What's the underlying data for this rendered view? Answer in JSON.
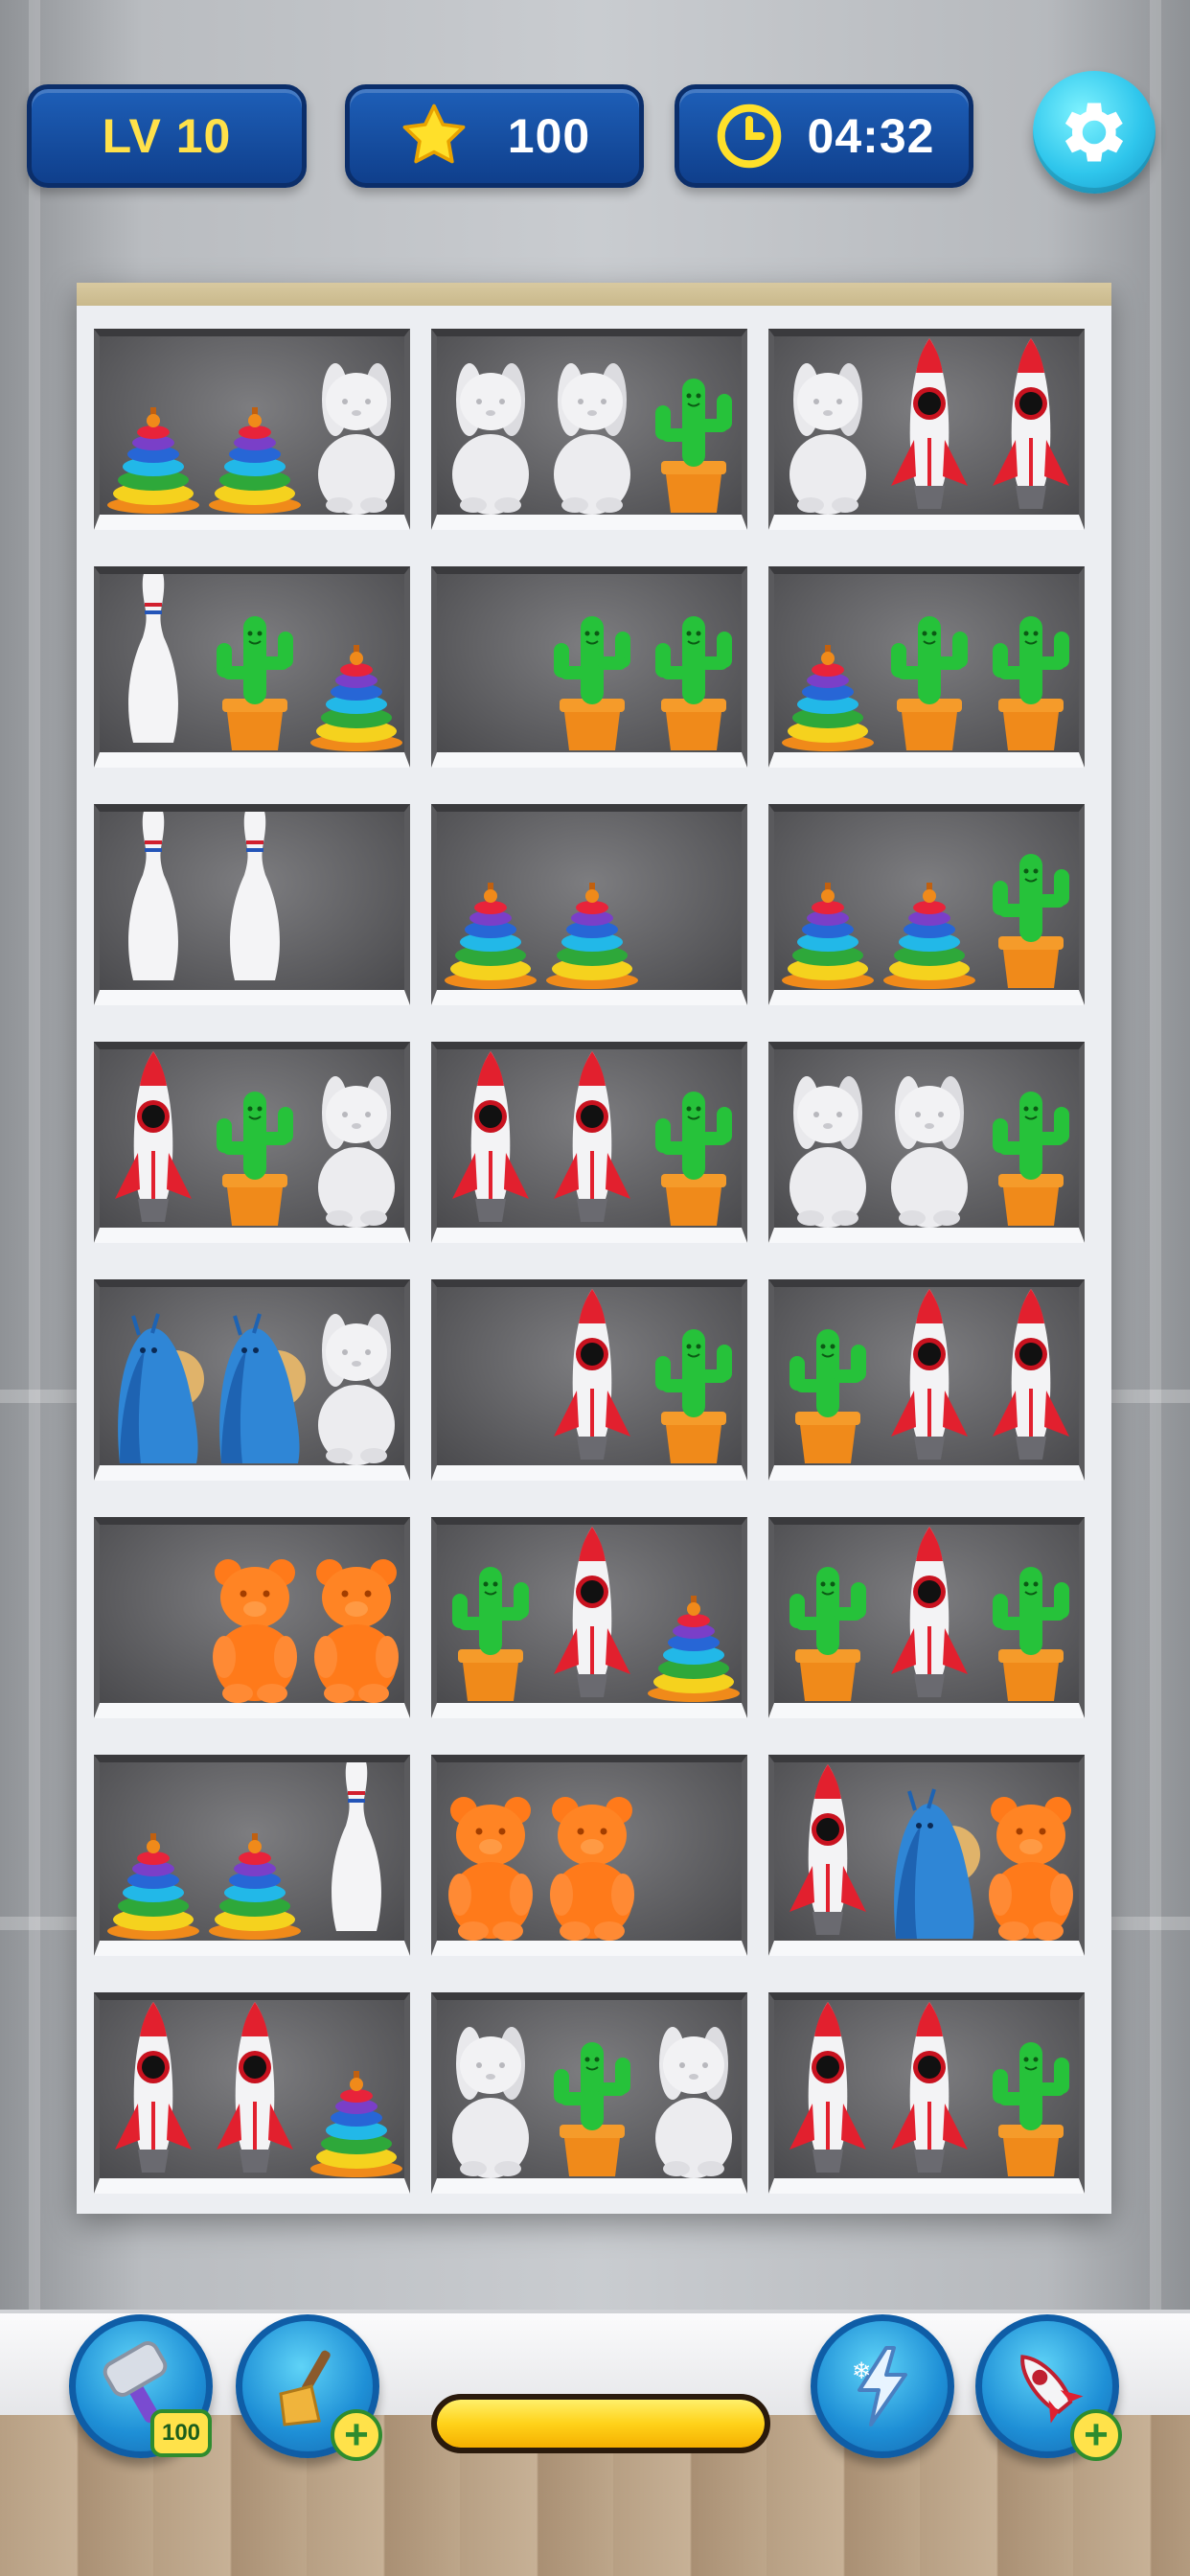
{
  "hud": {
    "level_label": "LV 10",
    "stars": "100",
    "timer": "04:32"
  },
  "shelf": {
    "rows": [
      [
        [
          "pyramid",
          "pyramid",
          "bunny"
        ],
        [
          "bunny",
          "bunny",
          "cactus"
        ],
        [
          "bunny",
          "rocket",
          "rocket"
        ]
      ],
      [
        [
          "pin",
          "cactus",
          "pyramid"
        ],
        [
          "empty",
          "cactus",
          "cactus"
        ],
        [
          "pyramid",
          "cactus",
          "cactus"
        ]
      ],
      [
        [
          "pin",
          "pin",
          "empty"
        ],
        [
          "pyramid",
          "pyramid",
          "empty"
        ],
        [
          "pyramid",
          "pyramid",
          "cactus"
        ]
      ],
      [
        [
          "rocket",
          "cactus",
          "bunny"
        ],
        [
          "rocket",
          "rocket",
          "cactus"
        ],
        [
          "bunny",
          "bunny",
          "cactus"
        ]
      ],
      [
        [
          "snail",
          "snail",
          "bunny"
        ],
        [
          "empty",
          "rocket",
          "cactus"
        ],
        [
          "cactus",
          "rocket",
          "rocket"
        ]
      ],
      [
        [
          "empty",
          "bear",
          "bear"
        ],
        [
          "cactus",
          "rocket",
          "pyramid"
        ],
        [
          "cactus",
          "rocket",
          "cactus"
        ]
      ],
      [
        [
          "pyramid",
          "pyramid",
          "pin"
        ],
        [
          "bear",
          "bear",
          "empty"
        ],
        [
          "rocket",
          "snail",
          "bear"
        ]
      ],
      [
        [
          "rocket",
          "rocket",
          "pyramid"
        ],
        [
          "bunny",
          "cactus",
          "bunny"
        ],
        [
          "rocket",
          "rocket",
          "cactus"
        ]
      ]
    ]
  },
  "boosters": {
    "hammer": {
      "icon": "hammer-icon",
      "count": "100"
    },
    "broom": {
      "icon": "broom-icon",
      "badge": "+"
    },
    "freeze": {
      "icon": "freeze-lightning-icon"
    },
    "rocket": {
      "icon": "rocket-icon",
      "badge": "+"
    }
  },
  "progress": {
    "fraction": 1.0
  },
  "colors": {
    "hud_blue": "#1e5fb8",
    "accent_yellow": "#ffe14a",
    "gear_cyan": "#2fc6ec"
  }
}
